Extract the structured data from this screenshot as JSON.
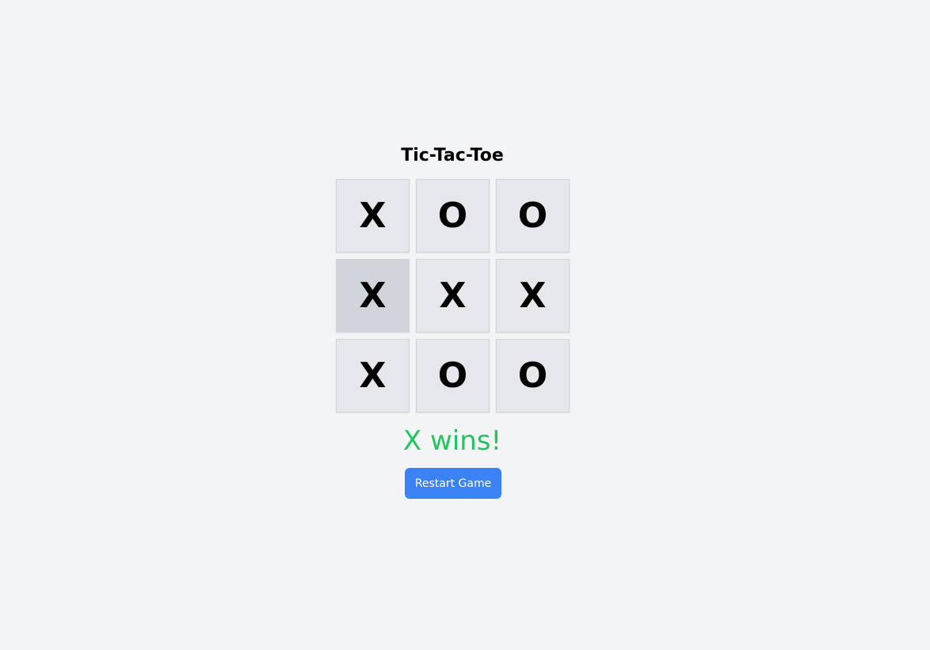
{
  "title": "Tic-Tac-Toe",
  "board": {
    "cells": [
      "X",
      "O",
      "O",
      "X",
      "X",
      "X",
      "X",
      "O",
      "O"
    ],
    "hovered_cell": 3
  },
  "status": "X wins!",
  "restart_label": "Restart Game",
  "colors": {
    "background": "#f3f4f6",
    "cell": "#e5e7eb",
    "cell_hover": "#d1d5db",
    "status": "#22c55e",
    "button": "#3b82f6"
  }
}
